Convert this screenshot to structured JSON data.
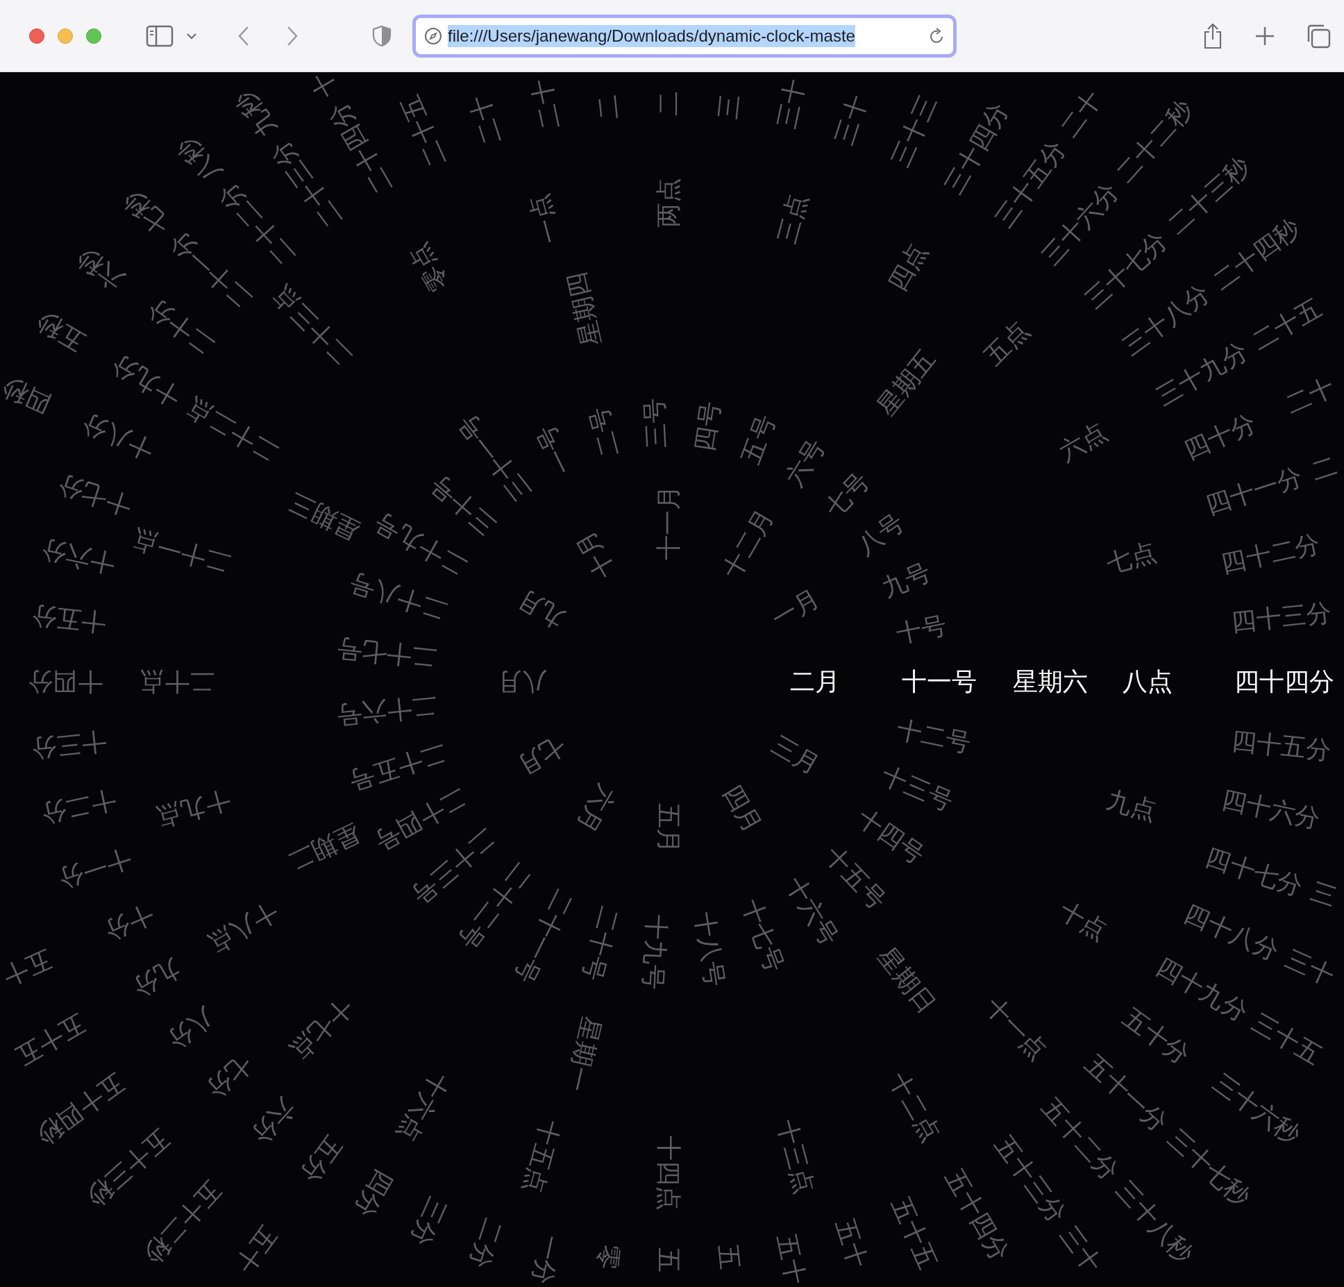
{
  "browser": {
    "url": "file:///Users/janewang/Downloads/dynamic-clock-maste",
    "text_selected": true
  },
  "clock": {
    "rings": [
      {
        "kind": "month",
        "labels": [
          {
            "text": "一月",
            "selected": false
          },
          {
            "text": "二月",
            "selected": true
          },
          {
            "text": "三月",
            "selected": false
          },
          {
            "text": "四月",
            "selected": false
          },
          {
            "text": "五月",
            "selected": false
          },
          {
            "text": "六月",
            "selected": false
          },
          {
            "text": "七月",
            "selected": false
          },
          {
            "text": "八月",
            "selected": false
          },
          {
            "text": "九月",
            "selected": false
          },
          {
            "text": "十月",
            "selected": false
          },
          {
            "text": "十一月",
            "selected": false
          },
          {
            "text": "十二月",
            "selected": false
          }
        ]
      },
      {
        "kind": "day",
        "labels": [
          {
            "text": "一号",
            "selected": false
          },
          {
            "text": "二号",
            "selected": false
          },
          {
            "text": "三号",
            "selected": false
          },
          {
            "text": "四号",
            "selected": false
          },
          {
            "text": "五号",
            "selected": false
          },
          {
            "text": "六号",
            "selected": false
          },
          {
            "text": "七号",
            "selected": false
          },
          {
            "text": "八号",
            "selected": false
          },
          {
            "text": "九号",
            "selected": false
          },
          {
            "text": "十号",
            "selected": false
          },
          {
            "text": "十一号",
            "selected": true
          },
          {
            "text": "十二号",
            "selected": false
          },
          {
            "text": "十三号",
            "selected": false
          },
          {
            "text": "十四号",
            "selected": false
          },
          {
            "text": "十五号",
            "selected": false
          },
          {
            "text": "十六号",
            "selected": false
          },
          {
            "text": "十七号",
            "selected": false
          },
          {
            "text": "十八号",
            "selected": false
          },
          {
            "text": "十九号",
            "selected": false
          },
          {
            "text": "二十号",
            "selected": false
          },
          {
            "text": "二十一号",
            "selected": false
          },
          {
            "text": "二十二号",
            "selected": false
          },
          {
            "text": "二十三号",
            "selected": false
          },
          {
            "text": "二十四号",
            "selected": false
          },
          {
            "text": "二十五号",
            "selected": false
          },
          {
            "text": "二十六号",
            "selected": false
          },
          {
            "text": "二十七号",
            "selected": false
          },
          {
            "text": "二十八号",
            "selected": false
          },
          {
            "text": "二十九号",
            "selected": false
          },
          {
            "text": "三十号",
            "selected": false
          },
          {
            "text": "三十一号",
            "selected": false
          }
        ]
      },
      {
        "kind": "weekday",
        "labels": [
          {
            "text": "星期六",
            "selected": true
          },
          {
            "text": "星期日",
            "selected": false
          },
          {
            "text": "星期一",
            "selected": false
          },
          {
            "text": "星期二",
            "selected": false
          },
          {
            "text": "星期三",
            "selected": false
          },
          {
            "text": "星期四",
            "selected": false
          },
          {
            "text": "星期五",
            "selected": false
          }
        ]
      },
      {
        "kind": "hour",
        "labels": [
          {
            "text": "零点",
            "selected": false
          },
          {
            "text": "一点",
            "selected": false
          },
          {
            "text": "两点",
            "selected": false
          },
          {
            "text": "三点",
            "selected": false
          },
          {
            "text": "四点",
            "selected": false
          },
          {
            "text": "五点",
            "selected": false
          },
          {
            "text": "六点",
            "selected": false
          },
          {
            "text": "七点",
            "selected": false
          },
          {
            "text": "八点",
            "selected": true
          },
          {
            "text": "九点",
            "selected": false
          },
          {
            "text": "十点",
            "selected": false
          },
          {
            "text": "十一点",
            "selected": false
          },
          {
            "text": "十二点",
            "selected": false
          },
          {
            "text": "十三点",
            "selected": false
          },
          {
            "text": "十四点",
            "selected": false
          },
          {
            "text": "十五点",
            "selected": false
          },
          {
            "text": "十六点",
            "selected": false
          },
          {
            "text": "十七点",
            "selected": false
          },
          {
            "text": "十八点",
            "selected": false
          },
          {
            "text": "十九点",
            "selected": false
          },
          {
            "text": "二十点",
            "selected": false
          },
          {
            "text": "二十一点",
            "selected": false
          },
          {
            "text": "二十二点",
            "selected": false
          },
          {
            "text": "二十三点",
            "selected": false
          }
        ]
      },
      {
        "kind": "minute",
        "labels": [
          {
            "text": "零",
            "selected": false
          },
          {
            "text": "一分",
            "selected": false
          },
          {
            "text": "二分",
            "selected": false
          },
          {
            "text": "三分",
            "selected": false
          },
          {
            "text": "四分",
            "selected": false
          },
          {
            "text": "五分",
            "selected": false
          },
          {
            "text": "六分",
            "selected": false
          },
          {
            "text": "七分",
            "selected": false
          },
          {
            "text": "八分",
            "selected": false
          },
          {
            "text": "九分",
            "selected": false
          },
          {
            "text": "十分",
            "selected": false
          },
          {
            "text": "十一分",
            "selected": false
          },
          {
            "text": "十二分",
            "selected": false
          },
          {
            "text": "十三分",
            "selected": false
          },
          {
            "text": "十四分",
            "selected": false
          },
          {
            "text": "十五分",
            "selected": false
          },
          {
            "text": "十六分",
            "selected": false
          },
          {
            "text": "十七分",
            "selected": false
          },
          {
            "text": "十八分",
            "selected": false
          },
          {
            "text": "十九分",
            "selected": false
          },
          {
            "text": "二十分",
            "selected": false
          },
          {
            "text": "二十一分",
            "selected": false
          },
          {
            "text": "二十二分",
            "selected": false
          },
          {
            "text": "二十三分",
            "selected": false
          },
          {
            "text": "二十四分",
            "selected": false
          },
          {
            "text": "二十五",
            "selected": false
          },
          {
            "text": "二十",
            "selected": false
          },
          {
            "text": "二十",
            "selected": false
          },
          {
            "text": "二",
            "selected": false
          },
          {
            "text": "二",
            "selected": false
          },
          {
            "text": "三",
            "selected": false
          },
          {
            "text": "三十",
            "selected": false
          },
          {
            "text": "三十",
            "selected": false
          },
          {
            "text": "三十三",
            "selected": false
          },
          {
            "text": "三十四分",
            "selected": false
          },
          {
            "text": "三十五分",
            "selected": false
          },
          {
            "text": "三十六分",
            "selected": false
          },
          {
            "text": "三十七分",
            "selected": false
          },
          {
            "text": "三十八分",
            "selected": false
          },
          {
            "text": "三十九分",
            "selected": false
          },
          {
            "text": "四十分",
            "selected": false
          },
          {
            "text": "四十一分",
            "selected": false
          },
          {
            "text": "四十二分",
            "selected": false
          },
          {
            "text": "四十三分",
            "selected": false
          },
          {
            "text": "四十四分",
            "selected": true
          },
          {
            "text": "四十五分",
            "selected": false
          },
          {
            "text": "四十六分",
            "selected": false
          },
          {
            "text": "四十七分",
            "selected": false
          },
          {
            "text": "四十八分",
            "selected": false
          },
          {
            "text": "四十九分",
            "selected": false
          },
          {
            "text": "五十分",
            "selected": false
          },
          {
            "text": "五十一分",
            "selected": false
          },
          {
            "text": "五十二分",
            "selected": false
          },
          {
            "text": "五十三分",
            "selected": false
          },
          {
            "text": "五十四分",
            "selected": false
          },
          {
            "text": "五十五",
            "selected": false
          },
          {
            "text": "五十",
            "selected": false
          },
          {
            "text": "五十",
            "selected": false
          },
          {
            "text": "五",
            "selected": false
          },
          {
            "text": "五",
            "selected": false
          }
        ]
      },
      {
        "kind": "second",
        "labels": [
          {
            "text": "四秒",
            "selected": false
          },
          {
            "text": "五秒",
            "selected": false
          },
          {
            "text": "六秒",
            "selected": false
          },
          {
            "text": "七秒",
            "selected": false
          },
          {
            "text": "八秒",
            "selected": false
          },
          {
            "text": "九秒",
            "selected": false
          },
          {
            "text": "十",
            "selected": false
          },
          {
            "text": "二十",
            "selected": false
          },
          {
            "text": "二十二秒",
            "selected": false
          },
          {
            "text": "二十三秒",
            "selected": false
          },
          {
            "text": "二十四秒",
            "selected": false
          },
          {
            "text": "二十五",
            "selected": false
          },
          {
            "text": "二十",
            "selected": false
          },
          {
            "text": "二",
            "selected": false
          },
          {
            "text": "三",
            "selected": false
          },
          {
            "text": "三十",
            "selected": false
          },
          {
            "text": "三十五",
            "selected": false
          },
          {
            "text": "三十六秒",
            "selected": false
          },
          {
            "text": "三十七秒",
            "selected": false
          },
          {
            "text": "三十八秒",
            "selected": false
          },
          {
            "text": "三十",
            "selected": false
          },
          {
            "text": "五十",
            "selected": false
          },
          {
            "text": "五十二秒",
            "selected": false
          },
          {
            "text": "五十三秒",
            "selected": false
          },
          {
            "text": "五十四秒",
            "selected": false
          },
          {
            "text": "五十五",
            "selected": false
          },
          {
            "text": "五十",
            "selected": false
          }
        ]
      }
    ]
  }
}
